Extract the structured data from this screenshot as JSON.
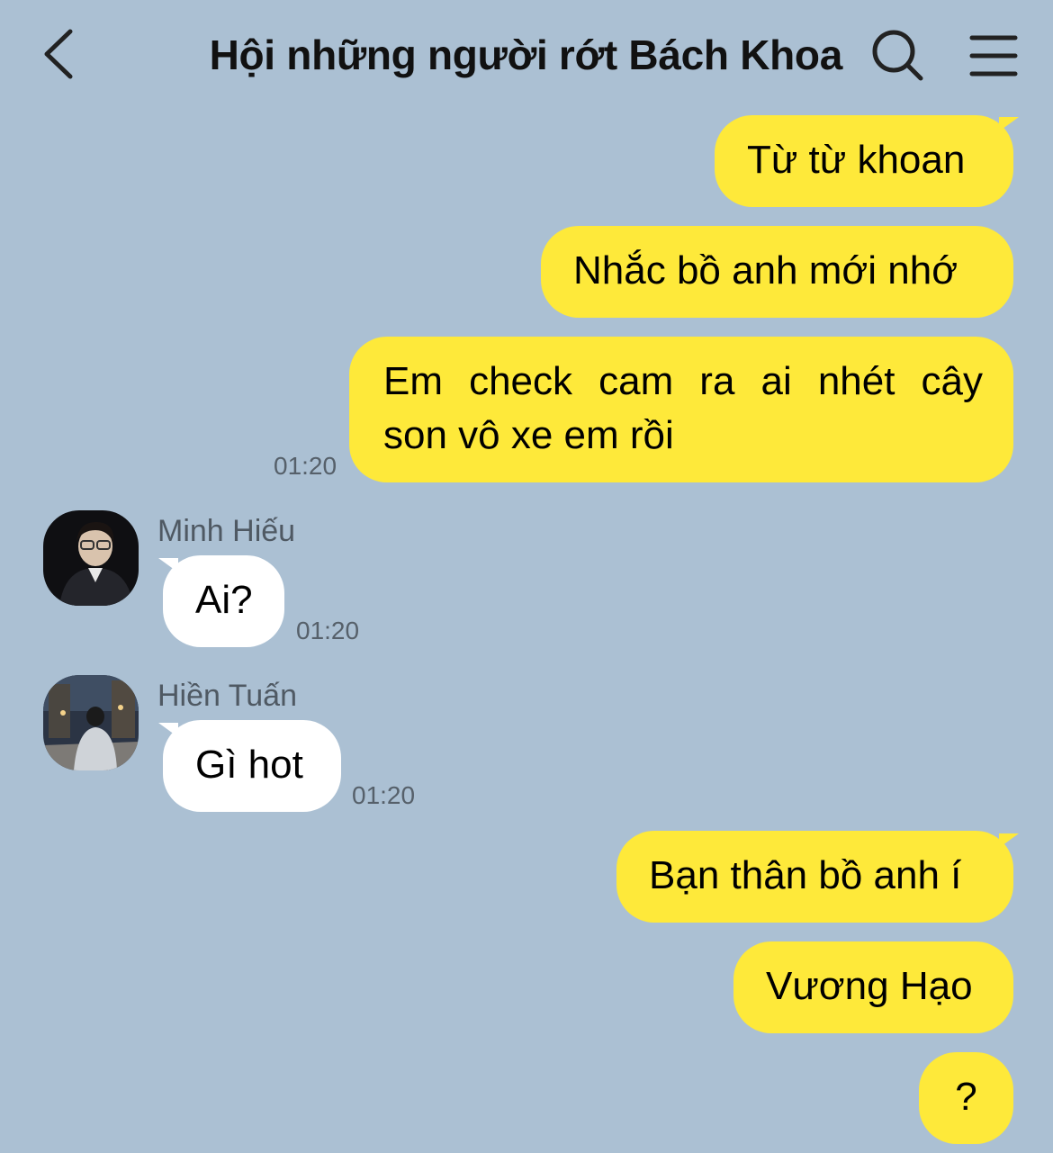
{
  "header": {
    "title": "Hội những người rớt Bách Khoa",
    "back_icon": "chevron-left-icon",
    "search_icon": "search-icon",
    "menu_icon": "hamburger-menu-icon"
  },
  "messages": [
    {
      "sender": "me",
      "text": "Từ từ khoan"
    },
    {
      "sender": "me",
      "text": "Nhắc bồ anh mới nhớ"
    },
    {
      "sender": "me",
      "lines": [
        "Em check cam ra ai nhét cây",
        "son vô xe em rồi"
      ],
      "time": "01:20"
    },
    {
      "sender": "Minh Hiếu",
      "text": "Ai?",
      "time": "01:20"
    },
    {
      "sender": "Hiền Tuấn",
      "text": "Gì hot",
      "time": "01:20"
    },
    {
      "sender": "me",
      "text": "Bạn thân bồ anh í"
    },
    {
      "sender": "me",
      "text": "Vương Hạo"
    },
    {
      "sender": "me",
      "text": "?"
    }
  ],
  "colors": {
    "background": "#abc0d3",
    "my_bubble": "#fee93a",
    "their_bubble": "#ffffff",
    "timestamp": "#56606a",
    "sender_name": "#4f5963"
  }
}
